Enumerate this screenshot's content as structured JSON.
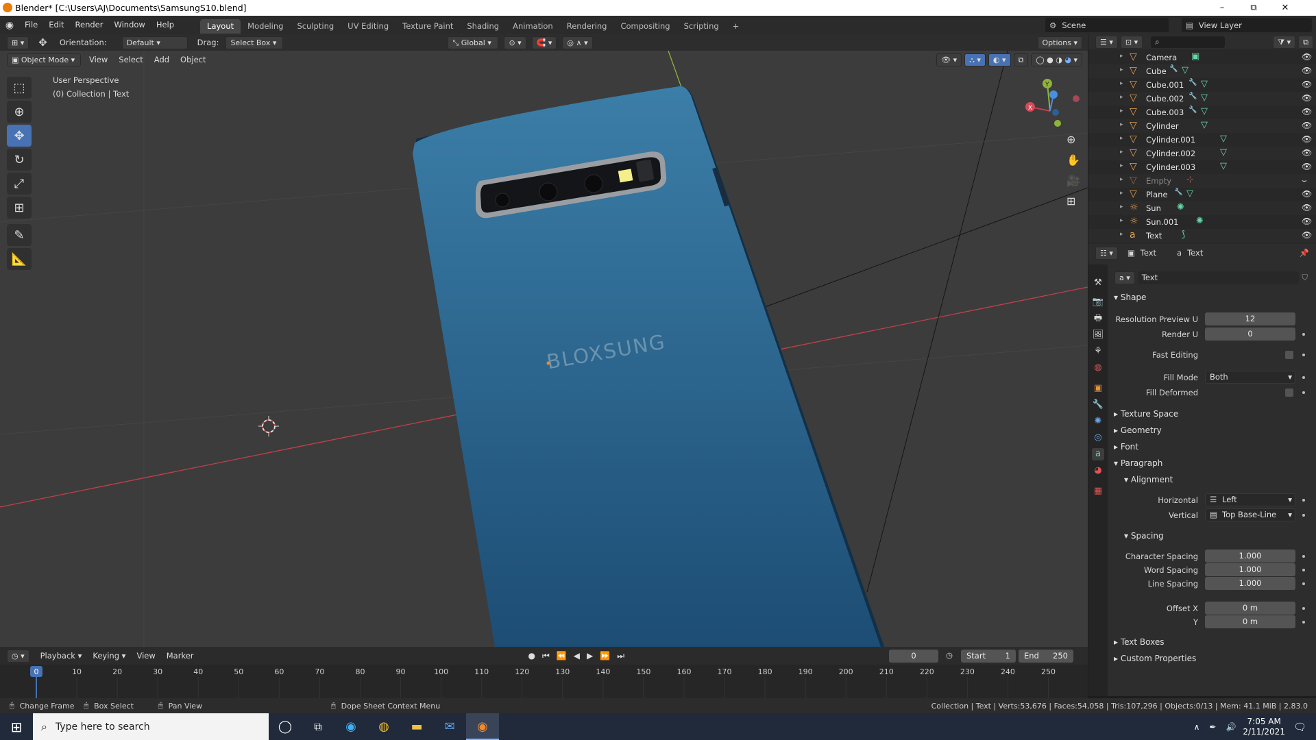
{
  "window": {
    "title": "Blender* [C:\\Users\\AJ\\Documents\\SamsungS10.blend]",
    "minimize": "–",
    "maximize": "⧉",
    "close": "✕"
  },
  "menubar": {
    "items": [
      "File",
      "Edit",
      "Render",
      "Window",
      "Help"
    ]
  },
  "workspaces": {
    "tabs": [
      "Layout",
      "Modeling",
      "Sculpting",
      "UV Editing",
      "Texture Paint",
      "Shading",
      "Animation",
      "Rendering",
      "Compositing",
      "Scripting"
    ],
    "active": "Layout",
    "add": "+"
  },
  "scene": {
    "scene_label": "Scene",
    "view_layer_label": "View Layer"
  },
  "tool_header": {
    "orientation_label": "Orientation:",
    "orientation_value": "Default",
    "drag_label": "Drag:",
    "drag_value": "Select Box",
    "transform_space": "Global",
    "options": "Options"
  },
  "viewport_header": {
    "mode": "Object Mode",
    "menus": [
      "View",
      "Select",
      "Add",
      "Object"
    ]
  },
  "viewport": {
    "perspective": "User Perspective",
    "collection": "(0) Collection | Text",
    "phone_text": "BLOXSUNG",
    "accent_blue": "#3b7ea8",
    "x_axis_color": "#c4404a",
    "y_axis_color": "#8fb339"
  },
  "outliner": {
    "items": [
      {
        "name": "Camera",
        "icon": "camera-data-icon"
      },
      {
        "name": "Cube",
        "icon": "mesh-icon"
      },
      {
        "name": "Cube.001",
        "icon": "mesh-icon"
      },
      {
        "name": "Cube.002",
        "icon": "mesh-icon"
      },
      {
        "name": "Cube.003",
        "icon": "mesh-icon"
      },
      {
        "name": "Cylinder",
        "icon": "mesh-icon"
      },
      {
        "name": "Cylinder.001",
        "icon": "mesh-icon"
      },
      {
        "name": "Cylinder.002",
        "icon": "mesh-icon"
      },
      {
        "name": "Cylinder.003",
        "icon": "mesh-icon"
      },
      {
        "name": "Empty",
        "icon": "empty-icon"
      },
      {
        "name": "Plane",
        "icon": "mesh-icon"
      },
      {
        "name": "Sun",
        "icon": "light-icon"
      },
      {
        "name": "Sun.001",
        "icon": "light-icon"
      },
      {
        "name": "Text",
        "icon": "text-icon"
      }
    ]
  },
  "properties": {
    "header_object": "Text",
    "header_data": "Text",
    "datablock": "Text",
    "shape": {
      "title": "Shape",
      "res_preview_label": "Resolution Preview U",
      "res_preview": "12",
      "render_u_label": "Render U",
      "render_u": "0",
      "fast_editing_label": "Fast Editing",
      "fill_mode_label": "Fill Mode",
      "fill_mode": "Both",
      "fill_deformed_label": "Fill Deformed"
    },
    "texture_space": "Texture Space",
    "geometry": "Geometry",
    "font": "Font",
    "paragraph": "Paragraph",
    "alignment": {
      "title": "Alignment",
      "horizontal_label": "Horizontal",
      "horizontal": "Left",
      "vertical_label": "Vertical",
      "vertical": "Top Base-Line"
    },
    "spacing": {
      "title": "Spacing",
      "char_label": "Character Spacing",
      "char": "1.000",
      "word_label": "Word Spacing",
      "word": "1.000",
      "line_label": "Line Spacing",
      "line": "1.000",
      "offset_x_label": "Offset X",
      "offset_x": "0 m",
      "y_label": "Y",
      "y": "0 m"
    },
    "text_boxes": "Text Boxes",
    "custom_props": "Custom Properties"
  },
  "timeline": {
    "menus": [
      "Playback",
      "Keying",
      "View",
      "Marker"
    ],
    "current_frame": "0",
    "start_label": "Start",
    "start": "1",
    "end_label": "End",
    "end": "250",
    "ticks": [
      "0",
      "10",
      "20",
      "30",
      "40",
      "50",
      "60",
      "70",
      "80",
      "90",
      "100",
      "110",
      "120",
      "130",
      "140",
      "150",
      "160",
      "170",
      "180",
      "190",
      "200",
      "210",
      "220",
      "230",
      "240",
      "250"
    ]
  },
  "statusbar": {
    "left": [
      "Change Frame",
      "Box Select",
      "Pan View",
      "Dope Sheet Context Menu"
    ],
    "right": "Collection | Text | Verts:53,676 | Faces:54,058 | Tris:107,296 | Objects:0/13 | Mem: 41.1 MiB | 2.83.0"
  },
  "taskbar": {
    "search_placeholder": "Type here to search",
    "time": "7:05 AM",
    "date": "2/11/2021"
  }
}
